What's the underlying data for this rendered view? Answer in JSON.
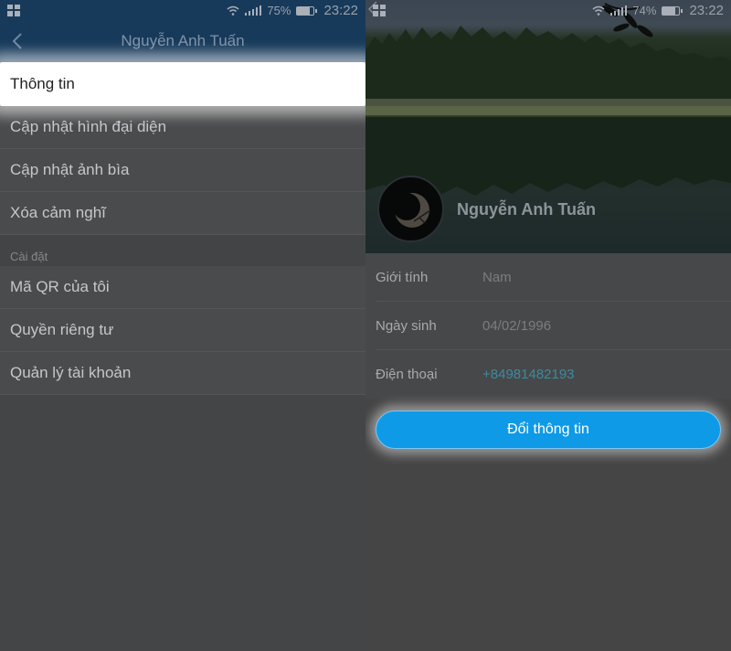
{
  "left_screen": {
    "status": {
      "battery": "75%",
      "battery_level": 0.75,
      "time": "23:22"
    },
    "header": {
      "title": "Nguyễn Anh Tuấn"
    },
    "menu": {
      "items": [
        {
          "label": "Thông tin"
        },
        {
          "label": "Cập nhật hình đại diện"
        },
        {
          "label": "Cập nhật ảnh bìa"
        },
        {
          "label": "Xóa cảm nghĩ"
        }
      ],
      "settings_section_label": "Cài đặt",
      "settings_items": [
        {
          "label": "Mã QR của tôi"
        },
        {
          "label": "Quyền riêng tư"
        },
        {
          "label": "Quản lý tài khoản"
        }
      ]
    }
  },
  "right_screen": {
    "status": {
      "battery": "74%",
      "battery_level": 0.74,
      "time": "23:22"
    },
    "profile": {
      "name": "Nguyễn Anh Tuấn"
    },
    "info": [
      {
        "label": "Giới tính",
        "value": "Nam"
      },
      {
        "label": "Ngày sinh",
        "value": "04/02/1996"
      },
      {
        "label": "Điện thoại",
        "value": "+84981482193"
      }
    ],
    "change_button_label": "Đổi thông tin"
  },
  "colors": {
    "header_bg": "#173a5b",
    "button_bg": "#0e9ae6",
    "phone_link": "#3d8a9e",
    "highlight": "#ffffff"
  }
}
